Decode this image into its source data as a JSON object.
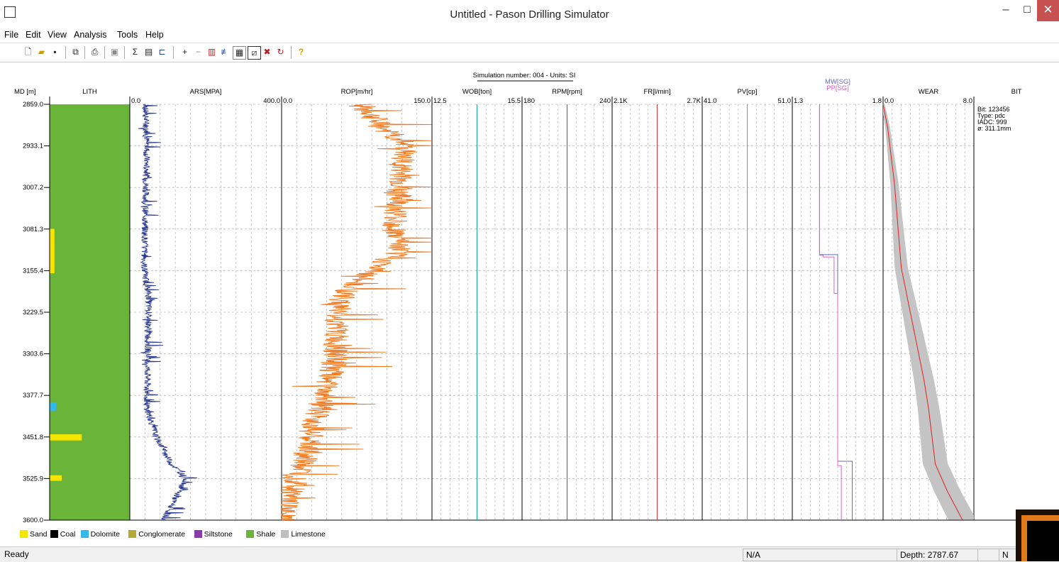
{
  "window": {
    "title": "Untitled - Pason Drilling Simulator"
  },
  "menu": [
    "File",
    "Edit",
    "View",
    "Analysis",
    "Tools",
    "Help"
  ],
  "toolbar": {
    "icons": [
      "new-file-icon",
      "open-folder-icon",
      "save-disk-icon",
      "copy-icon",
      "print-icon",
      "print-preview-icon",
      "sigma-icon",
      "statistics-icon",
      "track-icon",
      "zoom-in-icon",
      "zoom-out-icon",
      "bar-chart-icon",
      "split-icon",
      "grid-icon",
      "crop-icon",
      "delete-icon",
      "refresh-icon",
      "help-icon"
    ],
    "help_glyph": "?"
  },
  "chart": {
    "header": "Simulation number: 004 - Units: SI",
    "depth_label": "MD [m]",
    "depth_ticks": [
      "2859.0",
      "2933.1",
      "3007.2",
      "3081.3",
      "3155.4",
      "3229.5",
      "3303.6",
      "3377.7",
      "3451.8",
      "3525.9",
      "3600.0"
    ],
    "tracks": [
      {
        "key": "lith",
        "label": "LITH",
        "min": "",
        "max": ""
      },
      {
        "key": "ars",
        "label": "ARS[MPA]",
        "min": "0.0",
        "max": "400.0"
      },
      {
        "key": "rop",
        "label": "ROP[m/hr]",
        "min": "0.0",
        "max": "150.0"
      },
      {
        "key": "wob",
        "label": "WOB[ton]",
        "min": "12.5",
        "max": "15.5"
      },
      {
        "key": "rpm",
        "label": "RPM[rpm]",
        "min": "180",
        "max": "240"
      },
      {
        "key": "fr",
        "label": "FR[l/min]",
        "min": "2.1K",
        "max": "2.7K"
      },
      {
        "key": "pv",
        "label": "PV[cp]",
        "min": "41.0",
        "max": "51.0"
      },
      {
        "key": "mw",
        "label": "MW[SG]",
        "label2": "PP[SG]",
        "min": "1.3",
        "max": "1.8"
      },
      {
        "key": "wear",
        "label": "WEAR",
        "min": "0.0",
        "max": "8.0"
      },
      {
        "key": "bit",
        "label": "BIT",
        "min": "",
        "max": ""
      }
    ],
    "bit_info": [
      "Bit: 123456",
      "Type: pdc",
      "IADC: 999",
      "ø: 311.1mm"
    ]
  },
  "chart_data": {
    "type": "line",
    "title": "Simulation number: 004 - Units: SI",
    "y_axis": {
      "label": "MD [m]",
      "range": [
        2859.0,
        3600.0
      ],
      "inverted": true
    },
    "series": [
      {
        "name": "ARS[MPA]",
        "range": [
          0,
          400
        ],
        "color": "#2b3a8f",
        "depth": [
          2859,
          2933,
          3007,
          3081,
          3155,
          3200,
          3300,
          3400,
          3452,
          3500,
          3526,
          3560,
          3600
        ],
        "values": [
          40,
          45,
          42,
          40,
          38,
          50,
          48,
          45,
          70,
          110,
          150,
          120,
          90
        ]
      },
      {
        "name": "ROP[m/hr]",
        "range": [
          0,
          150
        ],
        "color": "#f07a20",
        "depth": [
          2859,
          2900,
          2933,
          2960,
          3007,
          3050,
          3081,
          3120,
          3155,
          3200,
          3260,
          3320,
          3390,
          3452,
          3500,
          3560,
          3600
        ],
        "values": [
          80,
          100,
          125,
          120,
          118,
          115,
          112,
          118,
          90,
          60,
          55,
          52,
          40,
          28,
          22,
          8,
          0
        ]
      },
      {
        "name": "WOB[ton]",
        "range": [
          12.5,
          15.5
        ],
        "color": "#16a090",
        "depth": [
          2859,
          3600
        ],
        "values": [
          14.0,
          14.0
        ]
      },
      {
        "name": "RPM[rpm]",
        "range": [
          180,
          240
        ],
        "color": "#8a3a9a",
        "depth": [
          2859,
          3600
        ],
        "values": [
          210,
          210
        ]
      },
      {
        "name": "FR[l/min]",
        "range": [
          2100,
          2700
        ],
        "color": "#e03a3a",
        "depth": [
          2859,
          3600
        ],
        "values": [
          2400,
          2400
        ]
      },
      {
        "name": "PV[cp]",
        "range": [
          41,
          51
        ],
        "color": "#5ab84a",
        "depth": [
          2859,
          3600
        ],
        "values": [
          46,
          46
        ]
      },
      {
        "name": "MW[SG]",
        "range": [
          1.3,
          1.8
        ],
        "color": "#6a6ab8",
        "depth": [
          2859,
          3127,
          3127,
          3495,
          3495,
          3600
        ],
        "values": [
          1.45,
          1.45,
          1.55,
          1.55,
          1.63,
          1.63
        ]
      },
      {
        "name": "PP[SG]",
        "range": [
          1.3,
          1.8
        ],
        "color": "#e060c8",
        "depth": [
          2859,
          3128,
          3128,
          3131,
          3131,
          3196,
          3196,
          3503,
          3503,
          3600
        ],
        "values": [
          1.45,
          1.45,
          1.47,
          1.47,
          1.53,
          1.53,
          1.55,
          1.55,
          1.57,
          1.57
        ]
      },
      {
        "name": "WEAR",
        "range": [
          0,
          8
        ],
        "color": "#e02020",
        "depth": [
          2859,
          2900,
          2950,
          3000,
          3050,
          3100,
          3150,
          3200,
          3250,
          3300,
          3350,
          3400,
          3450,
          3500,
          3550,
          3600
        ],
        "values": [
          0,
          0.4,
          0.7,
          1.0,
          1.2,
          1.4,
          1.6,
          2.1,
          2.6,
          3.1,
          3.6,
          4.0,
          4.3,
          4.6,
          5.7,
          7.0
        ]
      }
    ],
    "lithology": {
      "base": "Shale",
      "intervals": [
        {
          "top": 3081,
          "bottom": 3160,
          "type": "Sand",
          "extent": 0.06
        },
        {
          "top": 3390,
          "bottom": 3405,
          "type": "Dolomite",
          "extent": 0.08
        },
        {
          "top": 3447,
          "bottom": 3458,
          "type": "Sand",
          "extent": 0.4
        },
        {
          "top": 3520,
          "bottom": 3530,
          "type": "Sand",
          "extent": 0.15
        }
      ]
    },
    "legend": [
      {
        "name": "Sand",
        "color": "#f5e600"
      },
      {
        "name": "Coal",
        "color": "#000000"
      },
      {
        "name": "Dolomite",
        "color": "#34b8ec"
      },
      {
        "name": "Conglomerate",
        "color": "#b4aa32"
      },
      {
        "name": "Siltstone",
        "color": "#8a3aaa"
      },
      {
        "name": "Shale",
        "color": "#6ab43a"
      },
      {
        "name": "Limestone",
        "color": "#bebebe"
      }
    ]
  },
  "statusbar": {
    "left": "Ready",
    "pane1": "N/A",
    "pane2": "Depth: 2787.67",
    "pane3": "",
    "pane4": "N"
  }
}
